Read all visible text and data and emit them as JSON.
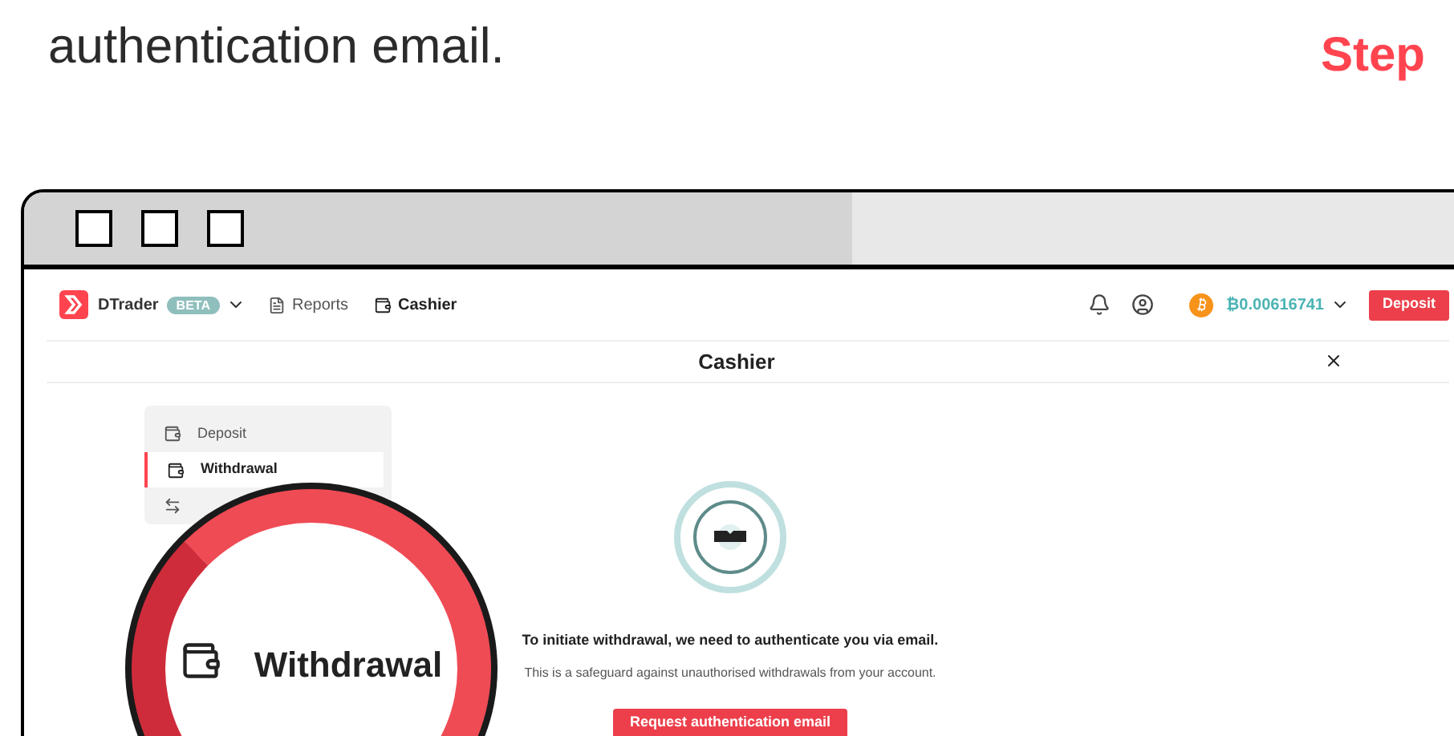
{
  "intro": {
    "text": "authentication email.",
    "step_label": "Step"
  },
  "header": {
    "app_name": "DTrader",
    "badge": "BETA",
    "nav": [
      {
        "label": "Reports",
        "selected": false
      },
      {
        "label": "Cashier",
        "selected": true
      }
    ],
    "balance": "₿0.00616741",
    "deposit_button": "Deposit"
  },
  "cashier": {
    "title": "Cashier",
    "menu": [
      {
        "label": "Deposit",
        "selected": false
      },
      {
        "label": "Withdrawal",
        "selected": true
      },
      {
        "selected": false
      }
    ]
  },
  "message": {
    "title": "To initiate withdrawal, we need to authenticate you via email.",
    "subtitle": "This is a safeguard against unauthorised withdrawals from your account.",
    "button": "Request authentication email"
  },
  "magnifier": {
    "label": "Withdrawal"
  }
}
